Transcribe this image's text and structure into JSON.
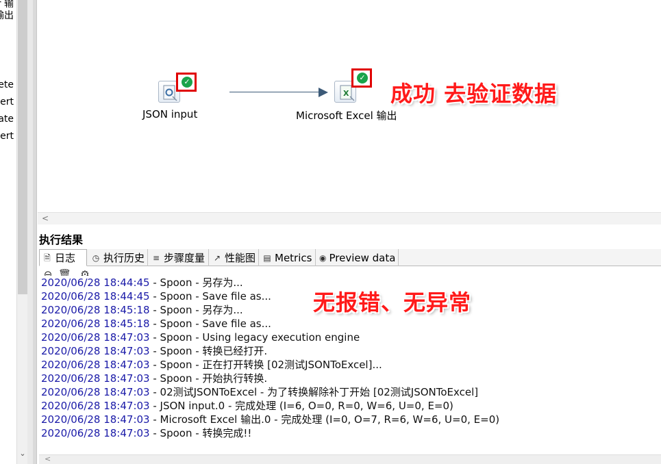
{
  "palette": {
    "items": [
      "r 输",
      "输出",
      "Delete",
      "Insert",
      "Update",
      "Upsert"
    ]
  },
  "canvas": {
    "steps": [
      {
        "label": "JSON input",
        "icon": "json-input-icon",
        "status": "success"
      },
      {
        "label": "Microsoft Excel 输出",
        "icon": "excel-output-icon",
        "status": "success"
      }
    ]
  },
  "annotations": {
    "success_note": "成功 去验证数据",
    "log_note": "无报错、无异常"
  },
  "results": {
    "title": "执行结果",
    "tabs": [
      {
        "label": "日志",
        "icon": "log-icon"
      },
      {
        "label": "执行历史",
        "icon": "history-icon"
      },
      {
        "label": "步骤度量",
        "icon": "step-metrics-icon"
      },
      {
        "label": "性能图",
        "icon": "performance-chart-icon"
      },
      {
        "label": "Metrics",
        "icon": "metrics-icon"
      },
      {
        "label": "Preview data",
        "icon": "preview-eye-icon"
      }
    ],
    "log_lines": [
      {
        "ts": "2020/06/28 18:44:45",
        "msg": " - Spoon - 另存为..."
      },
      {
        "ts": "2020/06/28 18:44:45",
        "msg": " - Spoon - Save file as..."
      },
      {
        "ts": "2020/06/28 18:45:18",
        "msg": " - Spoon - 另存为..."
      },
      {
        "ts": "2020/06/28 18:45:18",
        "msg": " - Spoon - Save file as..."
      },
      {
        "ts": "2020/06/28 18:47:03",
        "msg": " - Spoon - Using legacy execution engine"
      },
      {
        "ts": "2020/06/28 18:47:03",
        "msg": " - Spoon - 转换已经打开."
      },
      {
        "ts": "2020/06/28 18:47:03",
        "msg": " - Spoon - 正在打开转换 [02测试JSONToExcel]..."
      },
      {
        "ts": "2020/06/28 18:47:03",
        "msg": " - Spoon - 开始执行转换."
      },
      {
        "ts": "2020/06/28 18:47:03",
        "msg": " - 02测试JSONToExcel - 为了转换解除补丁开始  [02测试JSONToExcel]"
      },
      {
        "ts": "2020/06/28 18:47:03",
        "msg": " - JSON input.0 - 完成处理 (I=6, O=0, R=0, W=6, U=0, E=0)"
      },
      {
        "ts": "2020/06/28 18:47:03",
        "msg": " - Microsoft Excel 输出.0 - 完成处理 (I=0, O=7, R=6, W=6, U=0, E=0)"
      },
      {
        "ts": "2020/06/28 18:47:03",
        "msg": " - Spoon - 转换完成!!"
      }
    ]
  },
  "colors": {
    "timestamp": "#1a1aa8",
    "annotation": "#ff1a1a",
    "success": "#1aa34a",
    "highlight_box": "#e00000"
  }
}
